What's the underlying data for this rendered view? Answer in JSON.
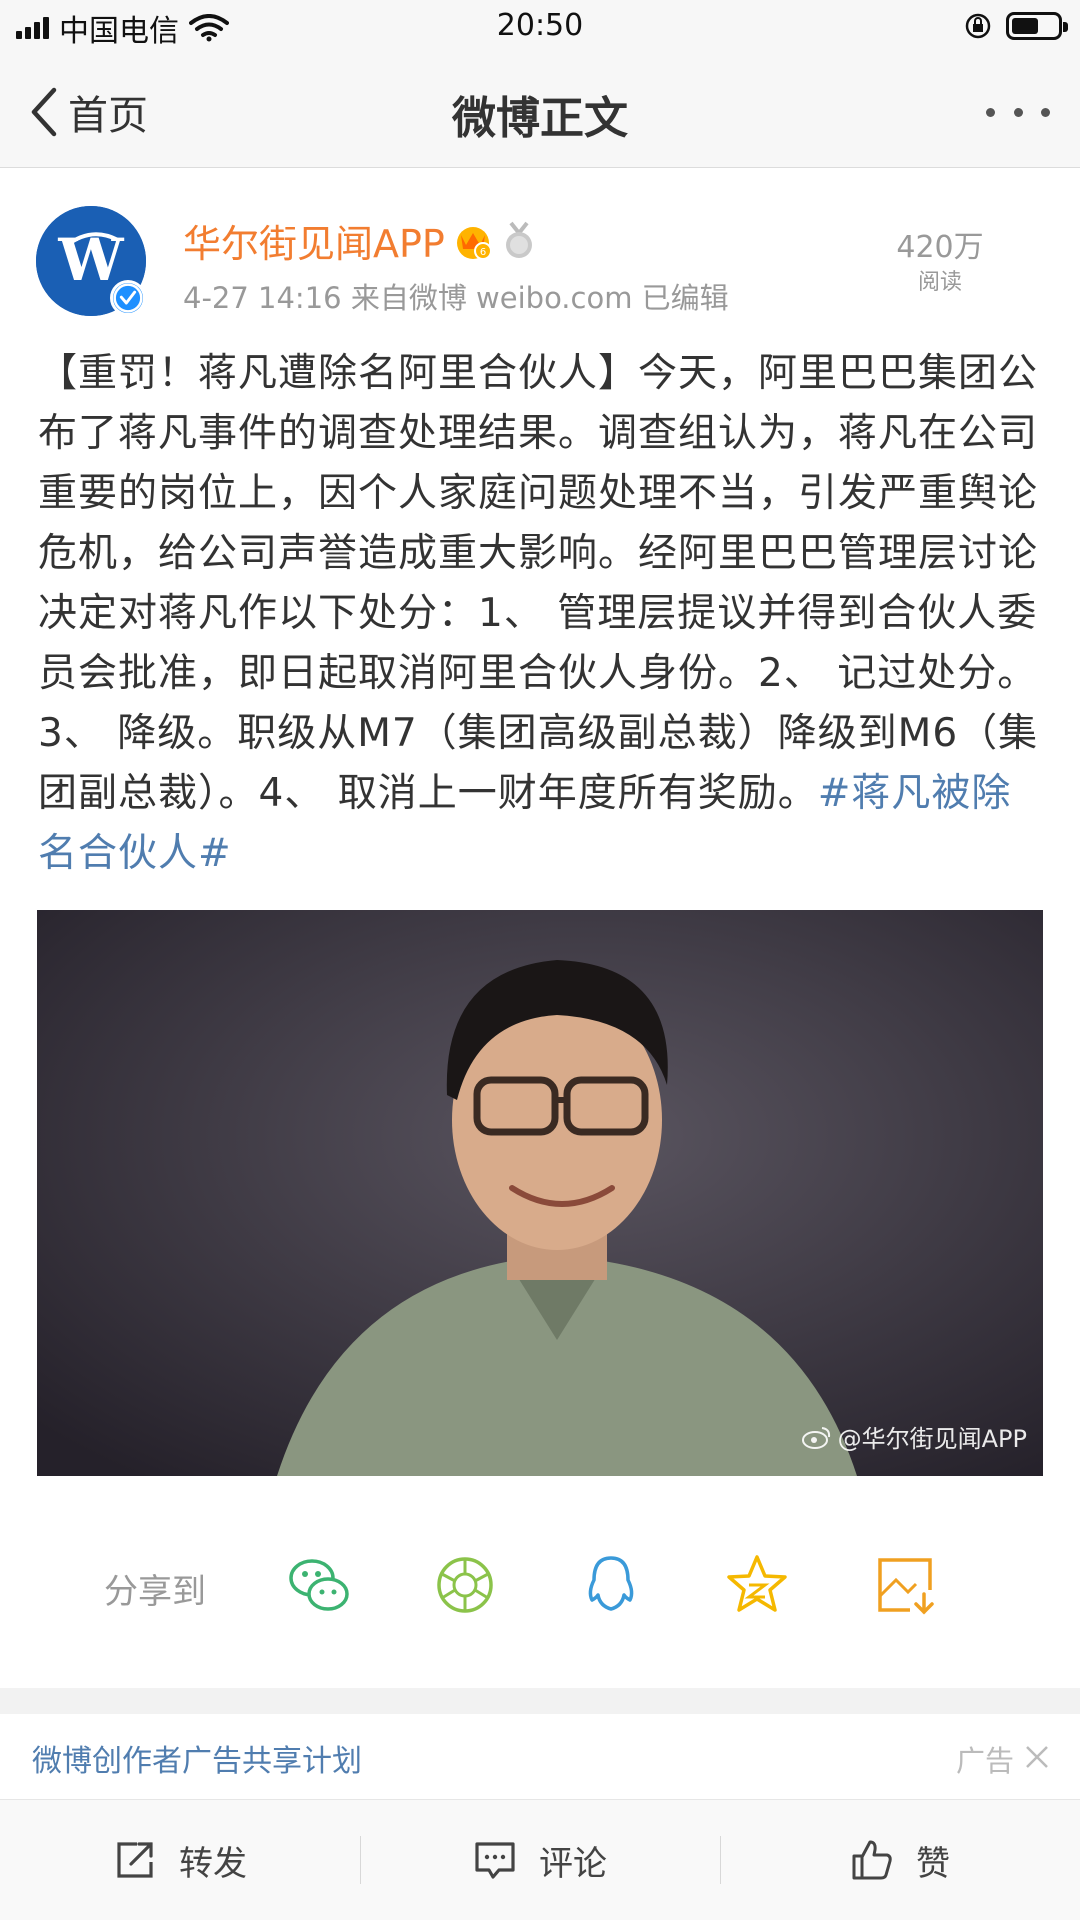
{
  "status_bar": {
    "carrier": "中国电信",
    "time": "20:50"
  },
  "nav": {
    "back_label": "首页",
    "title": "微博正文"
  },
  "post": {
    "author": "华尔街见闻APP",
    "avatar_letter": "W",
    "meta": "4-27 14:16  来自微博 weibo.com  已编辑",
    "reads_count": "420万",
    "reads_label": "阅读",
    "text": "【重罚！蒋凡遭除名阿里合伙人】今天，阿里巴巴集团公布了蒋凡事件的调查处理结果。调查组认为，蒋凡在公司重要的岗位上，因个人家庭问题处理不当，引发严重舆论危机，给公司声誉造成重大影响。经阿里巴巴管理层讨论决定对蒋凡作以下处分：1、 管理层提议并得到合伙人委员会批准，即日起取消阿里合伙人身份。2、 记过处分。3、 降级。职级从M7（集团高级副总裁）降级到M6（集团副总裁）。4、 取消上一财年度所有奖励。",
    "hashtag": "#蒋凡被除名合伙人#",
    "image_watermark": "@华尔街见闻APP"
  },
  "share": {
    "label": "分享到",
    "targets": [
      "wechat-icon",
      "moments-icon",
      "qq-icon",
      "qzone-icon",
      "save-image-icon"
    ]
  },
  "ad": {
    "text": "微博创作者广告共享计划",
    "tag": "广告"
  },
  "bottom_bar": {
    "repost": "转发",
    "comment": "评论",
    "like": "赞"
  },
  "colors": {
    "author": "#f27d30",
    "link": "#507daf",
    "avatar_bg": "#1a5fb4",
    "wechat": "#3cb371",
    "moments": "#8bc34a",
    "qq": "#3a9ad9",
    "qzone": "#f5b800",
    "save": "#f0a020"
  }
}
